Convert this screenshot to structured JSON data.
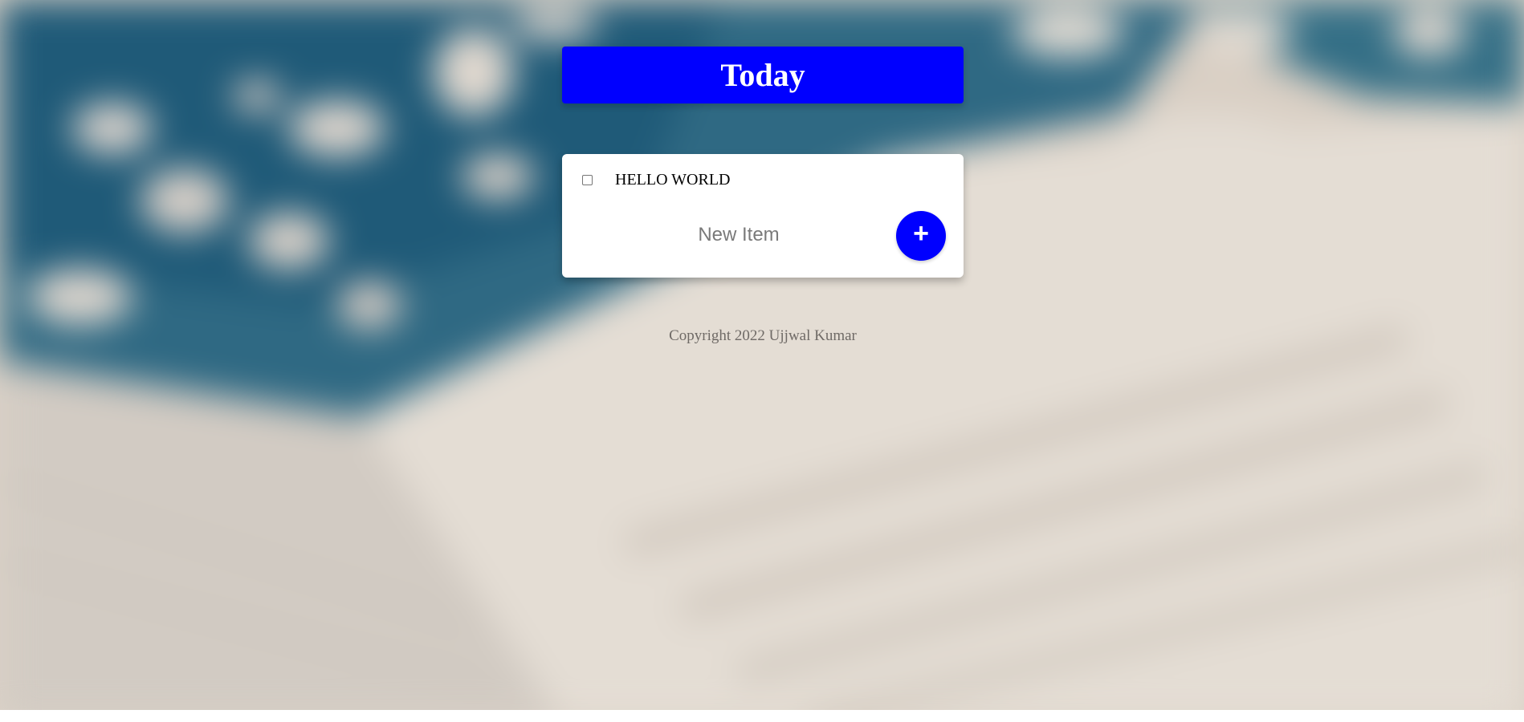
{
  "header": {
    "title": "Today"
  },
  "items": [
    {
      "label": "HELLO WORLD",
      "checked": false
    }
  ],
  "new_item": {
    "placeholder": "New Item",
    "value": ""
  },
  "add_button": {
    "label": "+"
  },
  "footer": {
    "text": "Copyright 2022 Ujjwal Kumar"
  },
  "colors": {
    "accent": "#0000ff",
    "card": "#ffffff",
    "footer_text": "#6f6a66"
  },
  "icons": [
    "plus-icon",
    "checkbox-icon"
  ]
}
